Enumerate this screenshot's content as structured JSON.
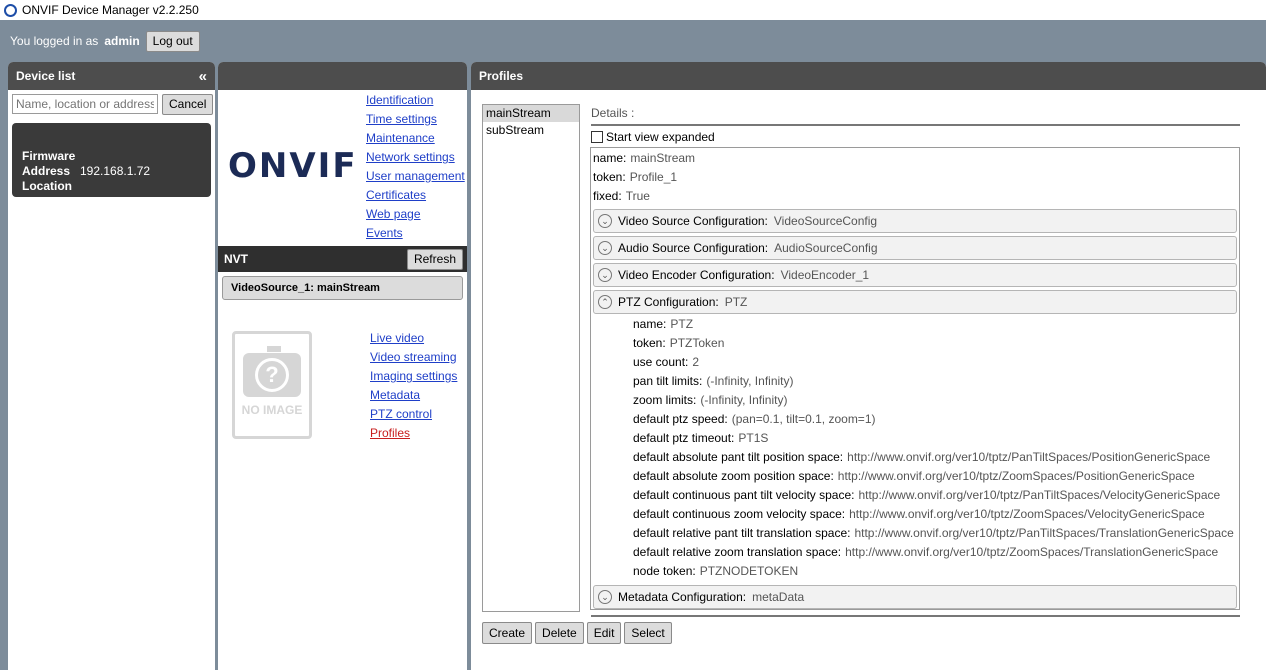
{
  "app": {
    "title": "ONVIF Device Manager v2.2.250"
  },
  "topbar": {
    "logged_prefix": "You logged in as",
    "user": "admin",
    "logout_label": "Log out"
  },
  "device_list": {
    "title": "Device list",
    "collapse_icon": "«",
    "search_placeholder": "Name, location or address",
    "cancel_label": "Cancel",
    "device": {
      "firmware_label": "Firmware",
      "address_label": "Address",
      "address": "192.168.1.72",
      "location_label": "Location"
    }
  },
  "identity": {
    "logo_text": "ONVIF",
    "links": [
      "Identification",
      "Time settings",
      "Maintenance",
      "Network settings",
      "User management",
      "Certificates",
      "Web page",
      "Events"
    ]
  },
  "nvt": {
    "title": "NVT",
    "refresh_label": "Refresh",
    "source": "VideoSource_1: mainStream",
    "no_image": "NO IMAGE",
    "links": [
      "Live video",
      "Video streaming",
      "Imaging settings",
      "Metadata",
      "PTZ control",
      "Profiles"
    ],
    "active_link": "Profiles"
  },
  "profiles": {
    "title": "Profiles",
    "list": [
      "mainStream",
      "subStream"
    ],
    "selected": "mainStream",
    "details_label": "Details :",
    "start_expanded_label": "Start view expanded",
    "props": [
      {
        "k": "name:",
        "v": "mainStream"
      },
      {
        "k": "token:",
        "v": "Profile_1"
      },
      {
        "k": "fixed:",
        "v": "True"
      }
    ],
    "sections": [
      {
        "k": "Video Source Configuration:",
        "v": "VideoSourceConfig",
        "icon": "chevron-down-icon"
      },
      {
        "k": "Audio Source Configuration:",
        "v": "AudioSourceConfig",
        "icon": "chevron-down-icon"
      },
      {
        "k": "Video Encoder Configuration:",
        "v": "VideoEncoder_1",
        "icon": "chevron-down-icon"
      },
      {
        "k": "PTZ Configuration:",
        "v": "PTZ",
        "icon": "chevron-up-icon"
      }
    ],
    "ptz": [
      {
        "k": "name:",
        "v": "PTZ"
      },
      {
        "k": "token:",
        "v": "PTZToken"
      },
      {
        "k": "use count:",
        "v": "2"
      },
      {
        "k": "pan tilt limits:",
        "v": "(-Infinity, Infinity)"
      },
      {
        "k": "zoom limits:",
        "v": "(-Infinity, Infinity)"
      },
      {
        "k": "default ptz speed:",
        "v": "(pan=0.1, tilt=0.1, zoom=1)"
      },
      {
        "k": "default ptz timeout:",
        "v": "PT1S"
      },
      {
        "k": "default absolute pant tilt position space:",
        "v": "http://www.onvif.org/ver10/tptz/PanTiltSpaces/PositionGenericSpace"
      },
      {
        "k": "default absolute zoom position space:",
        "v": "http://www.onvif.org/ver10/tptz/ZoomSpaces/PositionGenericSpace"
      },
      {
        "k": "default continuous pant tilt velocity space:",
        "v": "http://www.onvif.org/ver10/tptz/PanTiltSpaces/VelocityGenericSpace"
      },
      {
        "k": "default continuous zoom velocity space:",
        "v": "http://www.onvif.org/ver10/tptz/ZoomSpaces/VelocityGenericSpace"
      },
      {
        "k": "default relative pant tilt translation space:",
        "v": "http://www.onvif.org/ver10/tptz/PanTiltSpaces/TranslationGenericSpace"
      },
      {
        "k": "default relative zoom translation space:",
        "v": "http://www.onvif.org/ver10/tptz/ZoomSpaces/TranslationGenericSpace"
      },
      {
        "k": "node token:",
        "v": "PTZNODETOKEN"
      }
    ],
    "metadata_section": {
      "k": "Metadata Configuration:",
      "v": "metaData",
      "icon": "chevron-down-icon"
    },
    "buttons": [
      "Create",
      "Delete",
      "Edit",
      "Select"
    ]
  }
}
